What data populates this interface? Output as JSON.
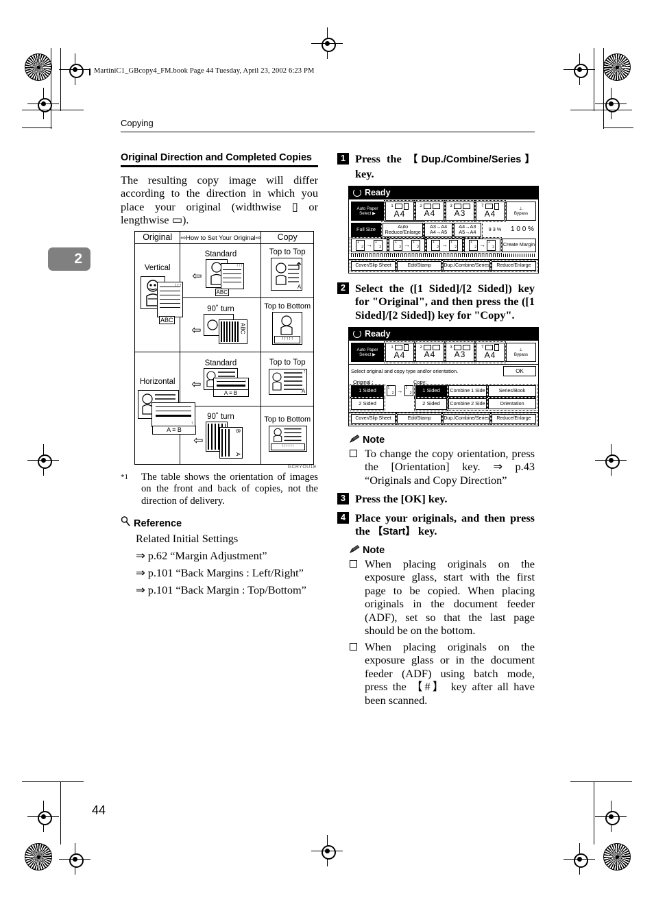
{
  "page": {
    "file_header": "MartiniC1_GBcopy4_FM.book  Page 44  Tuesday, April 23, 2002  6:23 PM",
    "running_head": "Copying",
    "chapter_tab": "2",
    "folio": "44"
  },
  "left": {
    "section_title": "Original Direction and Completed Copies",
    "intro": "The resulting copy image will differ according to the direction in which you place your original (widthwise ▯ or lengthwise ▭).",
    "figure": {
      "headers": [
        "Original",
        "How to Set Your Original",
        "Copy"
      ],
      "header_arrow_left": "⇨",
      "header_arrow_right": "⇨",
      "rows": [
        {
          "original": "Vertical",
          "sets": [
            {
              "how": "Standard",
              "copy": "Top to Top"
            },
            {
              "how": "90˚ turn",
              "copy": "Top to Bottom"
            }
          ]
        },
        {
          "original": "Horizontal",
          "sets": [
            {
              "how": "Standard",
              "copy": "Top to Top"
            },
            {
              "how": "90˚ turn",
              "copy": "Top to Bottom"
            }
          ]
        }
      ],
      "page_marks": {
        "abc": "ABC",
        "a": "A",
        "b": "B"
      },
      "figure_code": "GCRYOU1E"
    },
    "footnote_marker": "*1",
    "footnote": "The table shows the orientation of images on the front and back of copies, not the direction of delivery.",
    "reference_heading": "Reference",
    "reference_icon": "magnifier-icon",
    "reference_lines": [
      "Related Initial Settings",
      "⇒ p.62 “Margin Adjustment”",
      "⇒  p.101  “Back  Margins  : Left/Right”",
      "⇒ p.101 “Back Margin : Top/Bottom”"
    ]
  },
  "right": {
    "steps": [
      {
        "num": "1",
        "text_pre": "Press     the     ",
        "key": "【Dup./Combine/Series】",
        "text_post": " key."
      },
      {
        "num": "2",
        "text_pre": "Select the ([1 Sided]/[2 Sided]) key for \"Original\", and then press the ([1 Sided]/[2 Sided]) key for \"Copy\".",
        "key": "",
        "text_post": ""
      },
      {
        "num": "3",
        "text_pre": "Press the [OK] key.",
        "key": "",
        "text_post": ""
      },
      {
        "num": "4",
        "text_pre": "Place your originals, and then press the ",
        "key": "【Start】",
        "text_post": " key."
      }
    ],
    "note_heading": "Note",
    "note_icon": "pencil-icon",
    "note1_bullets": [
      "To change the copy orientation, press the [Orientation] key. ⇒ p.43 “Originals and Copy Direction”"
    ],
    "note2_bullets": [
      "When placing originals on the exposure glass, start with the first page to be copied. When placing originals in the document feeder (ADF), set so that the last page should be on the bottom.",
      "When placing originals on the exposure glass or in the document feeder (ADF) using batch mode, press the 【#】 key after all have been scanned."
    ]
  },
  "lcd1": {
    "status": "Ready",
    "status_icon": "power-icon",
    "auto_paper_select": "Auto Paper Select ▶",
    "trays": [
      {
        "num": "1",
        "size": "A4"
      },
      {
        "num": "2",
        "size": "A4"
      },
      {
        "num": "3",
        "size": "A3"
      },
      {
        "num": "T",
        "size": "A4"
      }
    ],
    "bypass": "Bypass",
    "bypass_icon": "bypass-tray-icon",
    "full_size": "Full Size",
    "auto_reduce": "Auto Reduce/Enlarge",
    "ratio_keys": [
      "A3→A4\nA4→A5",
      "A4→A3\nA5→A4"
    ],
    "ratio_93": "9 3 %",
    "ratio_100": "1 0 0 %",
    "duplex_keys": [
      "1→2",
      "2→2",
      "2→1",
      "1→Combine"
    ],
    "create_margin": "Create Margin",
    "tabs": [
      "Cover/Slip Sheet",
      "Edit/Stamp",
      "Dup./Combine/Series",
      "Reduce/Enlarge"
    ]
  },
  "lcd2": {
    "status": "Ready",
    "status_icon": "power-icon",
    "auto_paper_select": "Auto Paper Select ▶",
    "trays": [
      {
        "num": "1",
        "size": "A4"
      },
      {
        "num": "2",
        "size": "A4"
      },
      {
        "num": "3",
        "size": "A3"
      },
      {
        "num": "T",
        "size": "A4"
      }
    ],
    "bypass": "Bypass",
    "message": "Select original and copy type and/or orientation.",
    "ok": "OK",
    "original_label": "Original :",
    "copy_label": "Copy:",
    "original_keys": [
      "1 Sided",
      "2 Sided"
    ],
    "copy_keys": [
      "1 Sided",
      "2 Sided"
    ],
    "combine_keys": [
      "Combine 1 Side",
      "Combine 2 Side"
    ],
    "side_keys": [
      "Series/Book",
      "Orientation"
    ],
    "tabs": [
      "Cover/Slip Sheet",
      "Edit/Stamp",
      "Dup./Combine/Series",
      "Reduce/Enlarge"
    ]
  }
}
